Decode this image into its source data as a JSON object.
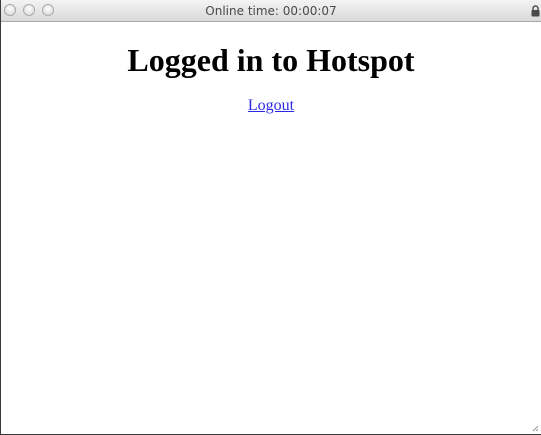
{
  "window": {
    "title": "Online time: 00:00:07",
    "icons": {
      "close": "close-button-icon",
      "minimize": "minimize-button-icon",
      "zoom": "zoom-button-icon",
      "lock": "lock-icon",
      "resize": "resize-grip-icon"
    }
  },
  "page": {
    "heading": "Logged in to Hotspot",
    "logout_label": "Logout"
  },
  "colors": {
    "link": "#2a2ae6",
    "heading": "#000000",
    "titlebar_text": "#4a4a4a"
  }
}
